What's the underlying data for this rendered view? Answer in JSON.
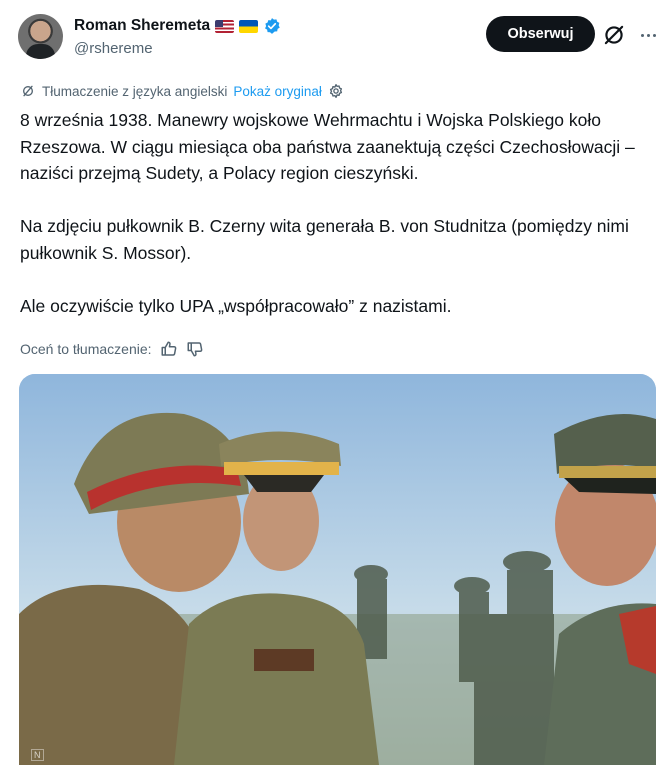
{
  "author": {
    "name": "Roman Sheremeta",
    "handle": "@rshereme",
    "flags": [
      "us-flag",
      "ukraine-flag"
    ],
    "verified_color": "#1d9bf0"
  },
  "actions": {
    "follow_label": "Obserwuj"
  },
  "translation": {
    "label": "Tłumaczenie z języka angielski",
    "show_original": "Pokaż oryginał"
  },
  "tweet": {
    "paragraph_1": "8 września 1938. Manewry wojskowe Wehrmachtu i Wojska Polskiego koło Rzeszowa. W ciągu miesiąca oba państwa zaanektują części Czechosłowacji – naziści przejmą Sudety, a Polacy region cieszyński.",
    "paragraph_2": "Na zdjęciu pułkownik B. Czerny wita generała B. von Studnitza (pomiędzy nimi pułkownik S. Mossor).",
    "paragraph_3": "Ale oczywiście tylko UPA „współpracowało” z nazistami."
  },
  "rating": {
    "label": "Oceń to tłumaczenie:"
  },
  "media": {
    "watermark": "N"
  },
  "colors": {
    "text": "#0f1419",
    "secondary": "#536471",
    "link": "#1d9bf0",
    "button_bg": "#0f1419"
  }
}
